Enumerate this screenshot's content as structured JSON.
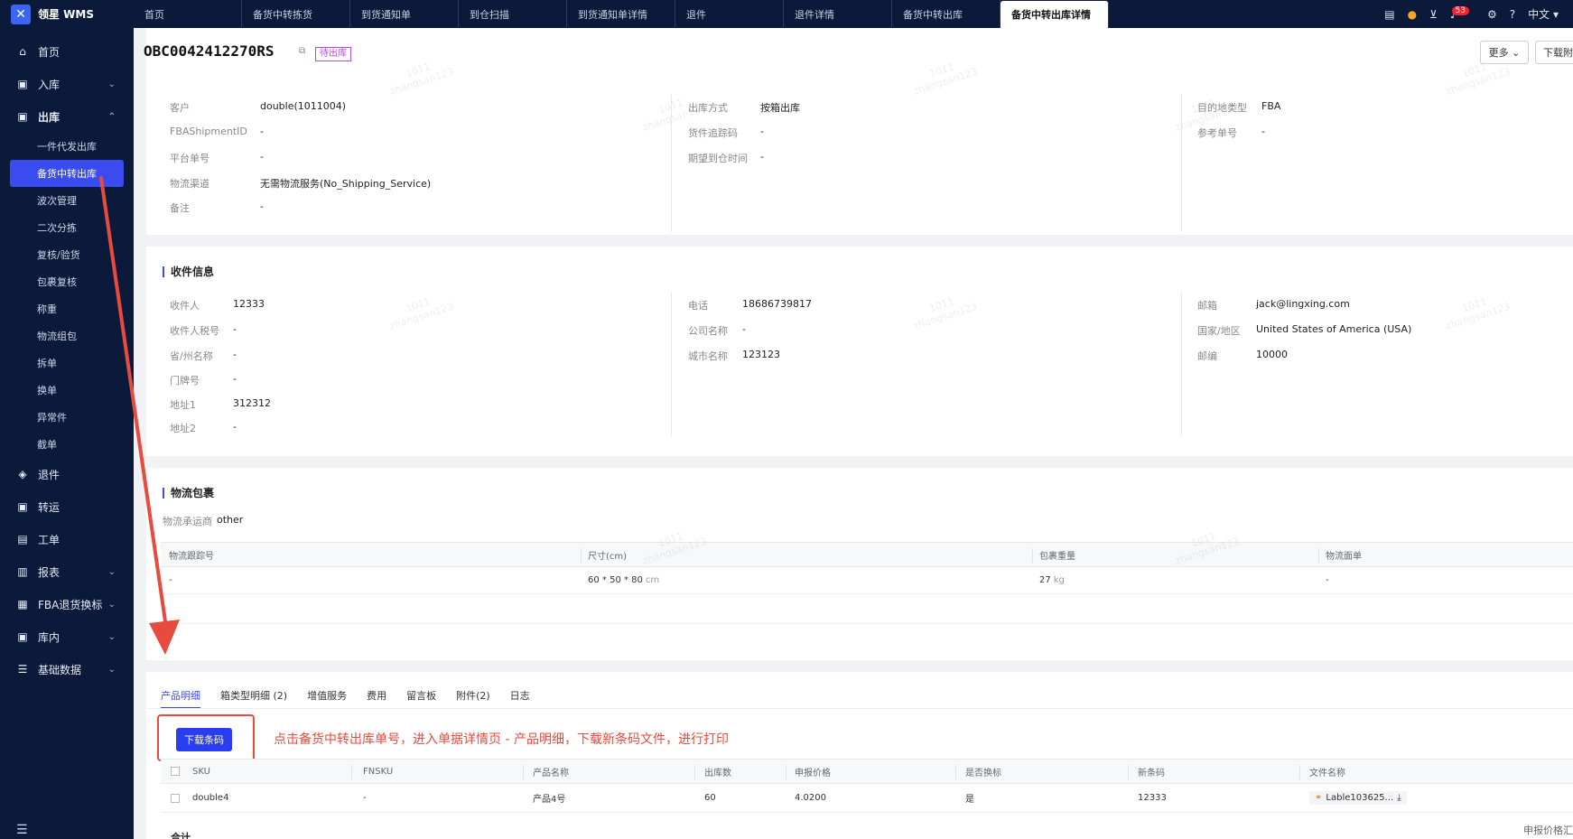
{
  "app": {
    "name": "领星 WMS"
  },
  "tabs": [
    {
      "label": "首页"
    },
    {
      "label": "备货中转拣货"
    },
    {
      "label": "到货通知单"
    },
    {
      "label": "到仓扫描"
    },
    {
      "label": "到货通知单详情"
    },
    {
      "label": "退件"
    },
    {
      "label": "退件详情"
    },
    {
      "label": "备货中转出库"
    },
    {
      "label": "备货中转出库详情"
    }
  ],
  "topbar": {
    "language": "中文",
    "notify_count": "53"
  },
  "sidebar": {
    "home": "首页",
    "inbound": "入库",
    "outbound": "出库",
    "outbound_items": [
      "一件代发出库",
      "备货中转出库",
      "波次管理",
      "二次分拣",
      "复核/验货",
      "包裹复核",
      "称重",
      "物流组包",
      "拆单",
      "换单",
      "异常件",
      "截单"
    ],
    "returns": "退件",
    "transfer": "转运",
    "workorder": "工单",
    "report": "报表",
    "fba": "FBA退货换标",
    "inventory": "库内",
    "basedata": "基础数据"
  },
  "header": {
    "order_no": "OBC0042412270RS",
    "status": "待出库",
    "more_label": "更多",
    "download_label": "下载附件"
  },
  "basic": {
    "customer_label": "客户",
    "customer": "double(1011004)",
    "fba_id_label": "FBAShipmentID",
    "fba_id": "-",
    "platform_no_label": "平台单号",
    "platform_no": "-",
    "channel_label": "物流渠道",
    "channel": "无需物流服务(No_Shipping_Service)",
    "remark_label": "备注",
    "remark": "-",
    "method_label": "出库方式",
    "method": "按箱出库",
    "tracking_label": "货件追踪码",
    "tracking": "-",
    "eta_label": "期望到仓时间",
    "eta": "-",
    "dest_type_label": "目的地类型",
    "dest_type": "FBA",
    "ref_label": "参考单号",
    "ref": "-"
  },
  "receiver": {
    "title": "收件信息",
    "name_label": "收件人",
    "name": "12333",
    "tax_label": "收件人税号",
    "tax": "-",
    "state_label": "省/州名称",
    "state": "-",
    "door_label": "门牌号",
    "door": "-",
    "addr1_label": "地址1",
    "addr1": "312312",
    "addr2_label": "地址2",
    "addr2": "-",
    "phone_label": "电话",
    "phone": "18686739817",
    "company_label": "公司名称",
    "company": "-",
    "city_label": "城市名称",
    "city": "123123",
    "email_label": "邮箱",
    "email": "jack@lingxing.com",
    "country_label": "国家/地区",
    "country": "United States of America (USA)",
    "zip_label": "邮编",
    "zip": "10000"
  },
  "logistics": {
    "title": "物流包裹",
    "carrier_label": "物流承运商",
    "carrier": "other",
    "headers": [
      "物流跟踪号",
      "尺寸(cm)",
      "包裹重量",
      "物流面单"
    ],
    "row": {
      "tracking": "-",
      "size": "60 * 50 * 80",
      "size_unit": "cm",
      "weight": "27",
      "weight_unit": "kg",
      "label": "-"
    }
  },
  "product_tabs": [
    "产品明细",
    "箱类型明细 (2)",
    "增值服务",
    "费用",
    "留言板",
    "附件(2)",
    "日志"
  ],
  "products": {
    "download_btn": "下载条码",
    "annotation": "点击备货中转出库单号，进入单据详情页 - 产品明细，下载新条码文件，进行打印",
    "headers": [
      "SKU",
      "FNSKU",
      "产品名称",
      "出库数",
      "申报价格",
      "是否换标",
      "新条码",
      "文件名称"
    ],
    "row": {
      "sku": "double4",
      "fnsku": "-",
      "name": "产品4号",
      "qty": "60",
      "price": "4.0200",
      "relabel": "是",
      "barcode": "12333",
      "file": "Lable103625..."
    },
    "total_label": "合计",
    "total_right": "申报价格汇"
  },
  "watermark": {
    "line1": "1011",
    "line2": "zhangsan123"
  },
  "colors": {
    "brand": "#3a4bf0",
    "sidebar_bg": "#0b1a3a",
    "annotation": "#e84a3e",
    "status": "#b34bd8"
  }
}
